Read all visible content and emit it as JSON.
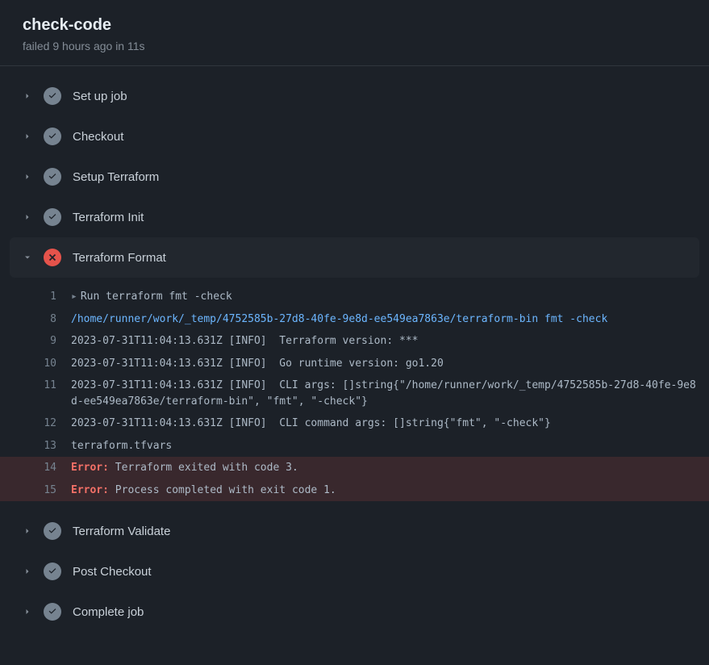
{
  "header": {
    "title": "check-code",
    "subtitle": "failed 9 hours ago in 11s"
  },
  "steps": [
    {
      "label": "Set up job",
      "status": "success",
      "expanded": false
    },
    {
      "label": "Checkout",
      "status": "success",
      "expanded": false
    },
    {
      "label": "Setup Terraform",
      "status": "success",
      "expanded": false
    },
    {
      "label": "Terraform Init",
      "status": "success",
      "expanded": false
    },
    {
      "label": "Terraform Format",
      "status": "fail",
      "expanded": true
    },
    {
      "label": "Terraform Validate",
      "status": "success",
      "expanded": false
    },
    {
      "label": "Post Checkout",
      "status": "success",
      "expanded": false
    },
    {
      "label": "Complete job",
      "status": "success",
      "expanded": false
    }
  ],
  "log": {
    "lines": [
      {
        "n": "1",
        "kind": "run",
        "text": "Run terraform fmt -check"
      },
      {
        "n": "8",
        "kind": "cmd",
        "text": "/home/runner/work/_temp/4752585b-27d8-40fe-9e8d-ee549ea7863e/terraform-bin fmt -check"
      },
      {
        "n": "9",
        "kind": "plain",
        "text": "2023-07-31T11:04:13.631Z [INFO]  Terraform version: ***"
      },
      {
        "n": "10",
        "kind": "plain",
        "text": "2023-07-31T11:04:13.631Z [INFO]  Go runtime version: go1.20"
      },
      {
        "n": "11",
        "kind": "plain",
        "text": "2023-07-31T11:04:13.631Z [INFO]  CLI args: []string{\"/home/runner/work/_temp/4752585b-27d8-40fe-9e8d-ee549ea7863e/terraform-bin\", \"fmt\", \"-check\"}"
      },
      {
        "n": "12",
        "kind": "plain",
        "text": "2023-07-31T11:04:13.631Z [INFO]  CLI command args: []string{\"fmt\", \"-check\"}"
      },
      {
        "n": "13",
        "kind": "plain",
        "text": "terraform.tfvars"
      },
      {
        "n": "14",
        "kind": "error",
        "label": "Error:",
        "text": " Terraform exited with code 3."
      },
      {
        "n": "15",
        "kind": "error",
        "label": "Error:",
        "text": " Process completed with exit code 1."
      }
    ]
  }
}
